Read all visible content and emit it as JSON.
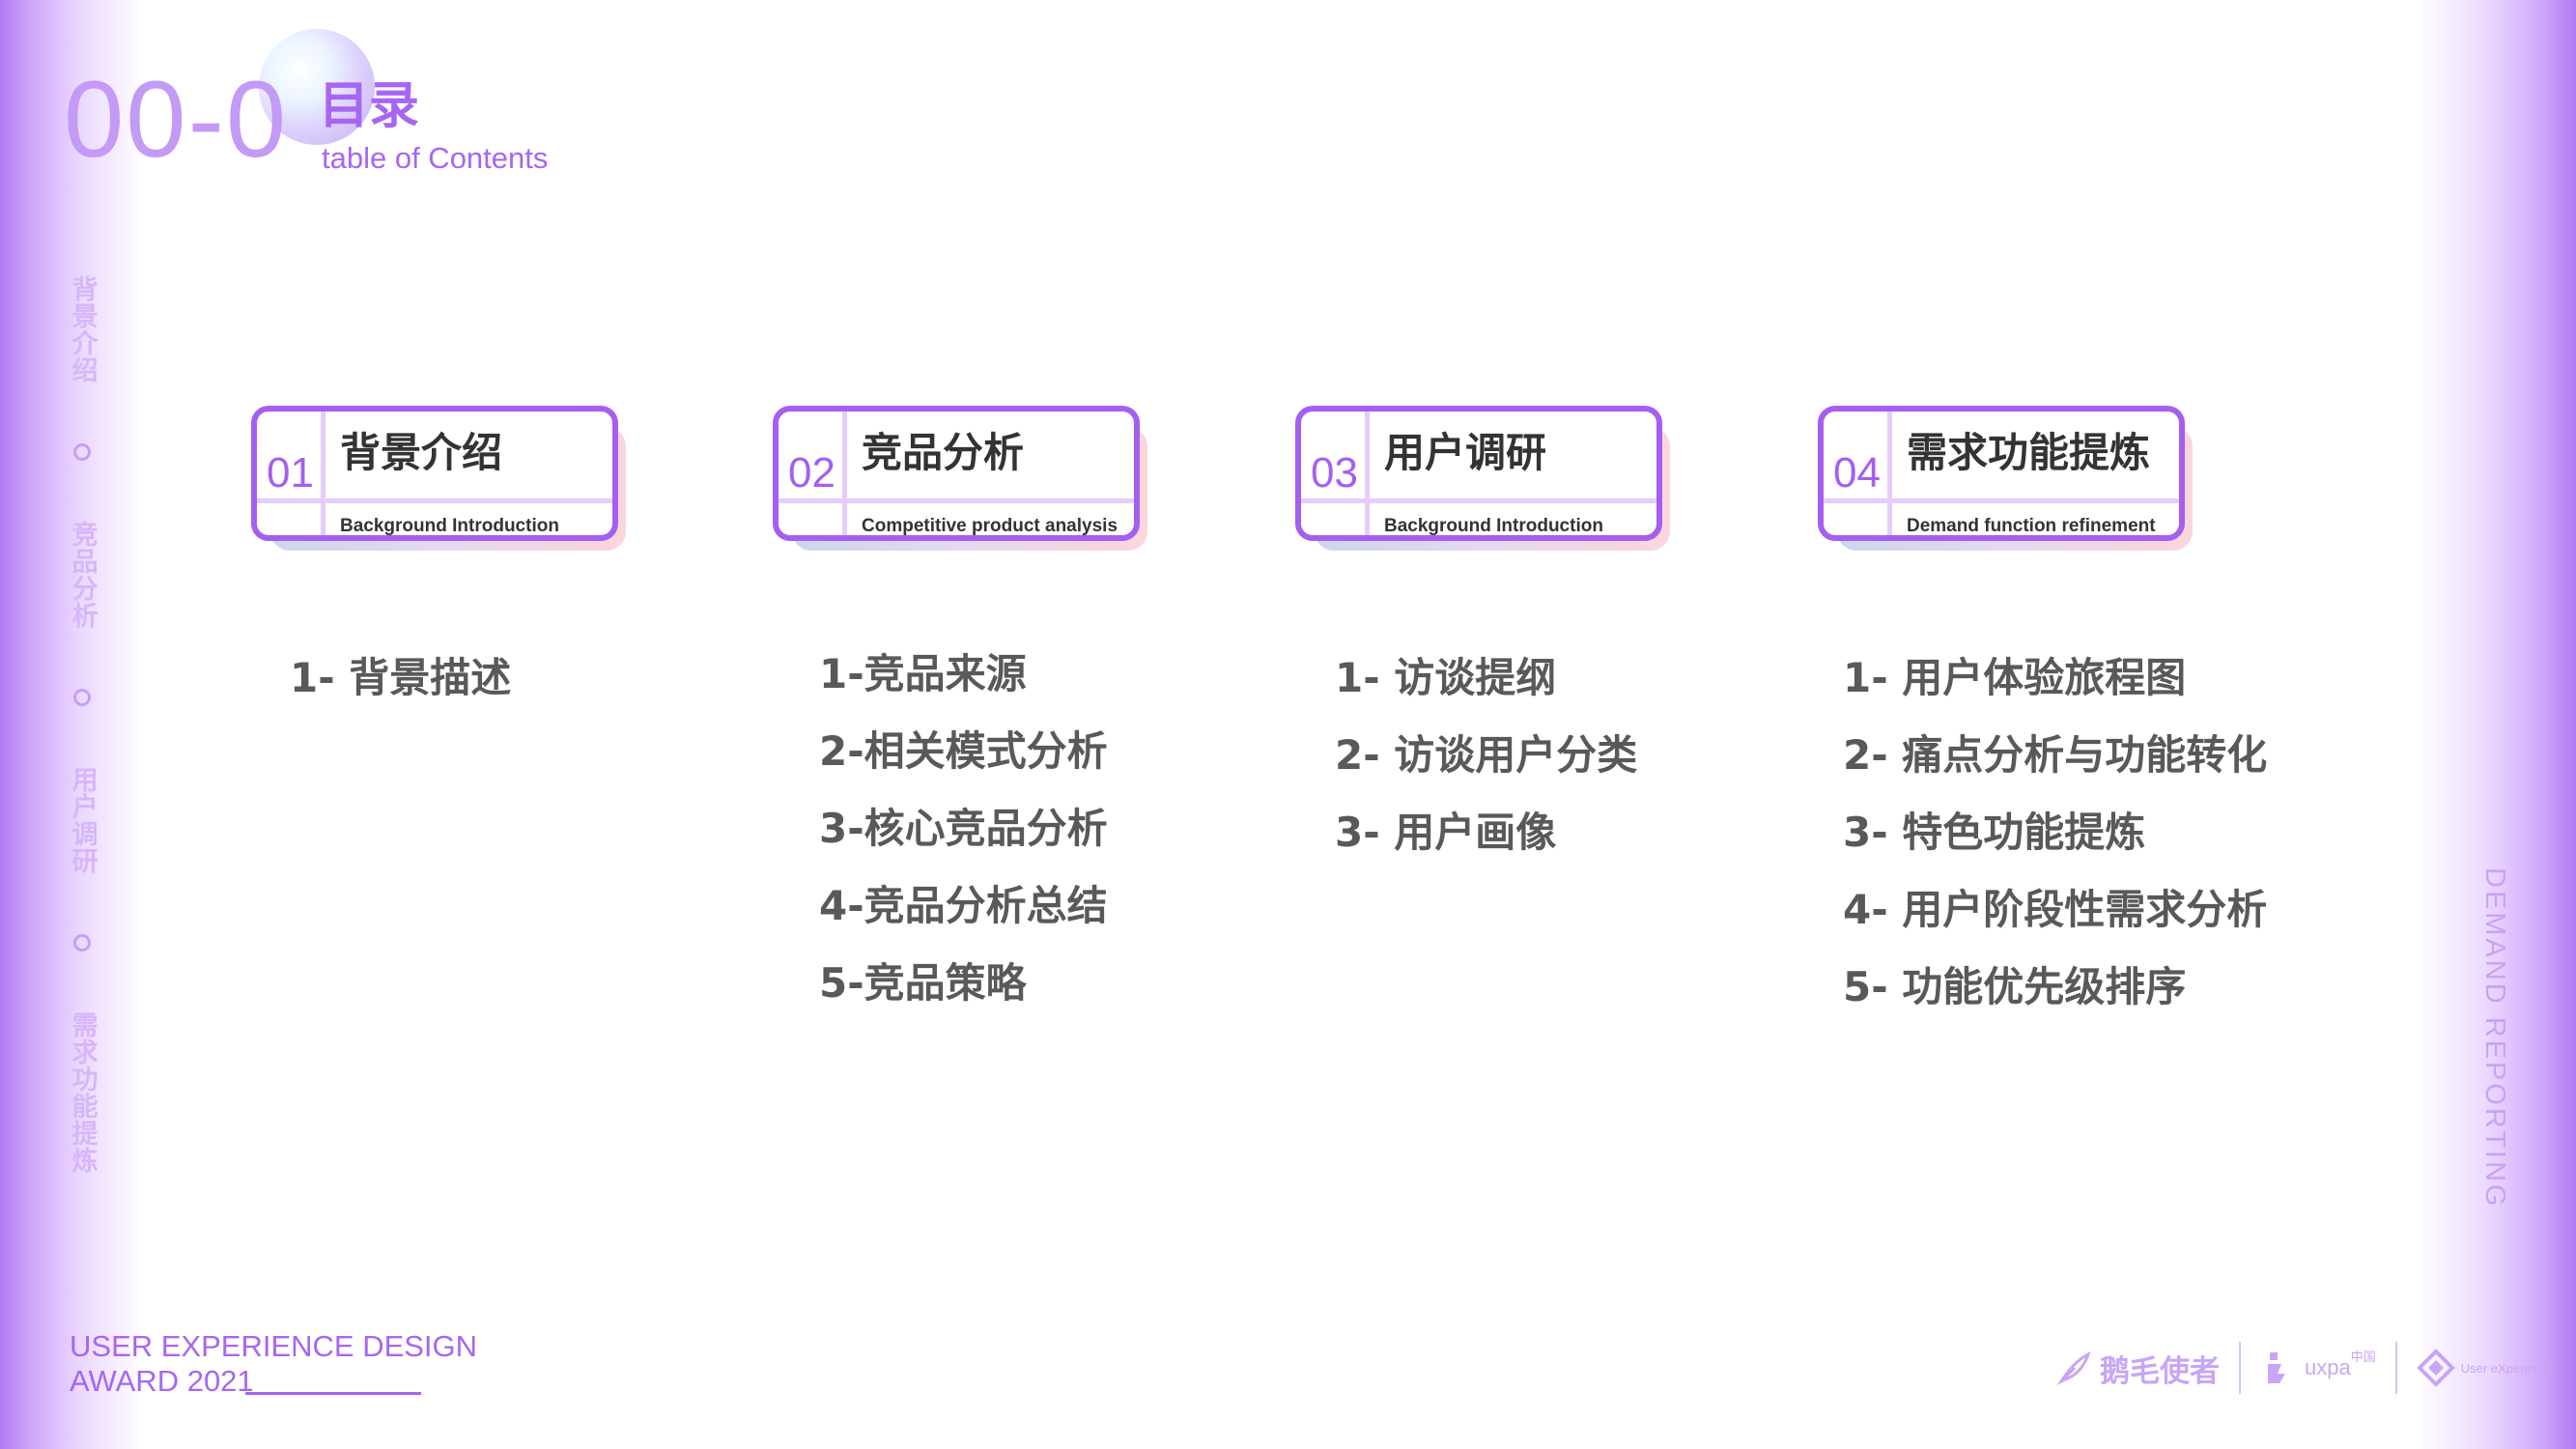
{
  "header": {
    "number": "00-0",
    "title": "目录",
    "subtitle": "table of Contents"
  },
  "side_nav": [
    "背景介绍",
    "竞品分析",
    "用户调研",
    "需求功能提炼"
  ],
  "side_right": "DEMAND REPORTING",
  "sections": [
    {
      "num": "01",
      "title": "背景介绍",
      "subtitle": "Background Introduction",
      "items": [
        "1- 背景描述"
      ]
    },
    {
      "num": "02",
      "title": "竞品分析",
      "subtitle": "Competitive product analysis",
      "items": [
        "1-竞品来源",
        "2-相关模式分析",
        "3-核心竞品分析",
        "4-竞品分析总结",
        "5-竞品策略"
      ]
    },
    {
      "num": "03",
      "title": "用户调研",
      "subtitle": "Background Introduction",
      "items": [
        "1- 访谈提纲",
        "2- 访谈用户分类",
        "3- 用户画像"
      ]
    },
    {
      "num": "04",
      "title": "需求功能提炼",
      "subtitle": "Demand function refinement",
      "items": [
        "1- 用户体验旅程图",
        "2- 痛点分析与功能转化",
        "3- 特色功能提炼",
        "4- 用户阶段性需求分析",
        "5- 功能优先级排序"
      ]
    }
  ],
  "footer": {
    "award_line1": "USER EXPERIENCE DESIGN",
    "award_line2": "AWARD 2021",
    "logos": {
      "brand": "鹅毛使者",
      "uxpa": "uxpa",
      "uxpa_badge": "中国",
      "ux": "User eXperience"
    }
  },
  "colors": {
    "accent": "#a45ff1",
    "text": "#333333",
    "list_text": "#595959",
    "side_text": "#d7b6fb"
  }
}
